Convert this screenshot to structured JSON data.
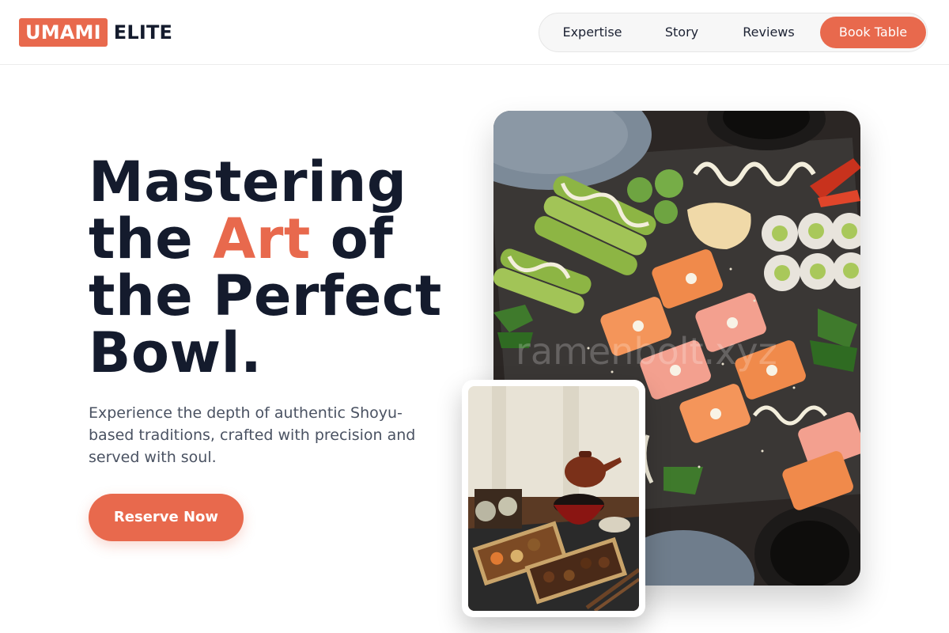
{
  "brand": {
    "mark": "UMAMI",
    "name": "ELITE"
  },
  "nav": {
    "links": [
      "Expertise",
      "Story",
      "Reviews"
    ],
    "cta": "Book Table"
  },
  "hero": {
    "headline_1": "Mastering",
    "headline_2a": "the ",
    "headline_accent": "Art",
    "headline_2b": " of",
    "headline_3": "the Perfect",
    "headline_4": "Bowl.",
    "description": "Experience the depth of authentic Shoyu-based traditions, crafted with precision and served with soul.",
    "button": "Reserve Now"
  },
  "images": {
    "main_watermark": "ramenbolt.xyz"
  },
  "colors": {
    "accent": "#e8694d",
    "heading": "#141b2d",
    "body_text": "#4a5262"
  }
}
